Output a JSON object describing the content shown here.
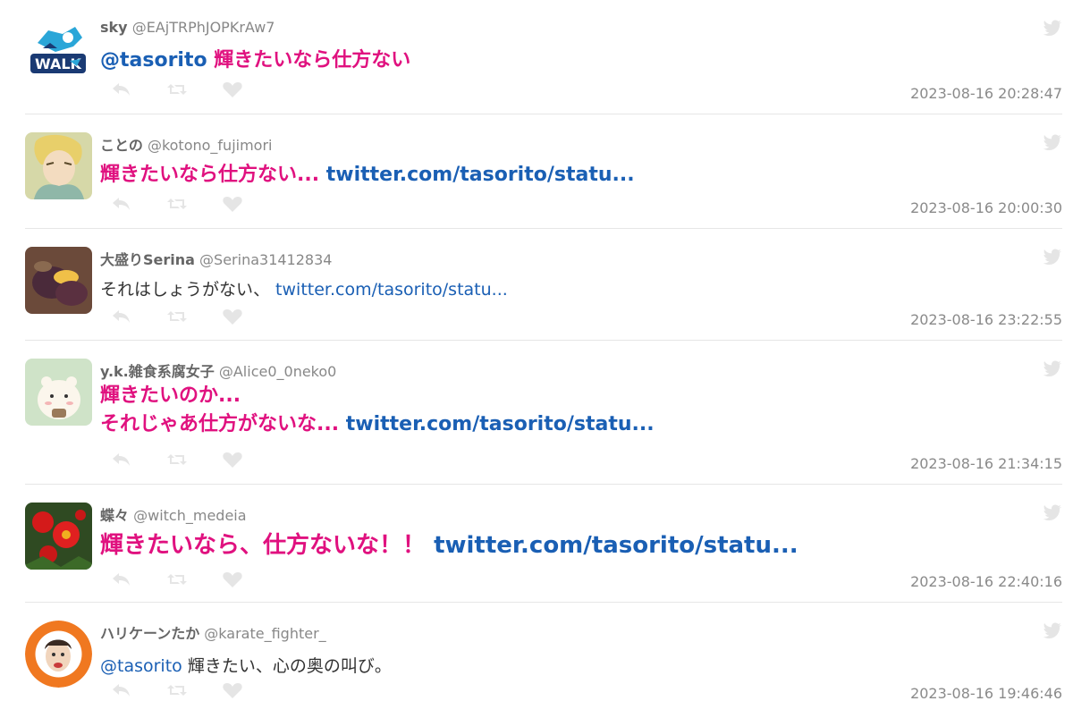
{
  "tweets": [
    {
      "name": "sky",
      "handle": "@EAjTRPhJOPKrAw7",
      "mention": "@tasorito",
      "body": " 輝きたいなら仕方ない",
      "link": "",
      "time": "2023-08-16 20:28:47",
      "avatar_text": "WALK"
    },
    {
      "name": "ことの",
      "handle": "@kotono_fujimori",
      "mention": "",
      "body": "輝きたいなら仕方ない... ",
      "link": "twitter.com/tasorito/statu...",
      "time": "2023-08-16 20:00:30"
    },
    {
      "name": "大盛りSerina",
      "handle": "@Serina31412834",
      "mention": "",
      "body": "それはしょうがない、 ",
      "link": "twitter.com/tasorito/statu...",
      "time": "2023-08-16 23:22:55"
    },
    {
      "name": "y.k.雑食系腐女子",
      "handle": "@Alice0_0neko0",
      "mention": "",
      "body_line1": "輝きたいのか...",
      "body_line2": "それじゃあ仕方がないな... ",
      "link": "twitter.com/tasorito/statu...",
      "time": "2023-08-16 21:34:15"
    },
    {
      "name": "蝶々",
      "handle": "@witch_medeia",
      "mention": "",
      "body": "輝きたいなら、仕方ないな！！ ",
      "link": "twitter.com/tasorito/statu...",
      "time": "2023-08-16 22:40:16"
    },
    {
      "name": "ハリケーンたか",
      "handle": "@karate_fighter_",
      "mention": "@tasorito",
      "body": " 輝きたい、心の奥の叫び。",
      "link": "",
      "time": "2023-08-16 19:46:46"
    }
  ],
  "icons": {
    "reply": "reply-icon",
    "retweet": "retweet-icon",
    "like": "heart-icon",
    "bird": "twitter-bird-icon"
  },
  "colors": {
    "pink": "#e0117f",
    "link": "#1a5fb4",
    "icon": "#e5e5e5"
  }
}
